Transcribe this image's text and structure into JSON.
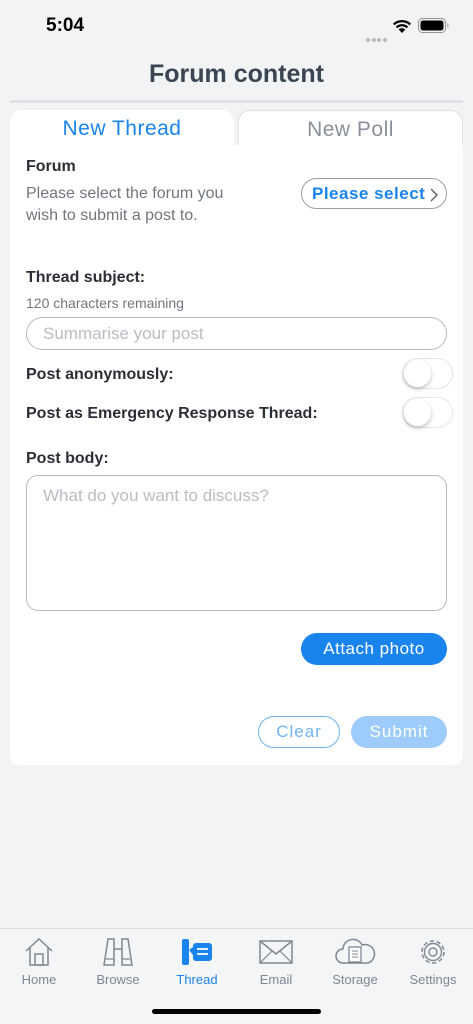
{
  "status_bar": {
    "time": "5:04"
  },
  "page": {
    "title": "Forum content"
  },
  "tabs": [
    {
      "label": "New Thread",
      "active": true
    },
    {
      "label": "New Poll",
      "active": false
    }
  ],
  "form": {
    "forum": {
      "label": "Forum",
      "hint_line1": "Please select the forum you",
      "hint_line2": "wish to submit a post to.",
      "select_label": "Please select"
    },
    "subject": {
      "label": "Thread subject:",
      "remaining": "120 characters remaining",
      "value": "",
      "placeholder": "Summarise your post"
    },
    "anonymous": {
      "label": "Post anonymously:",
      "on": false
    },
    "emergency": {
      "label": "Post as Emergency Response Thread:",
      "on": false
    },
    "body": {
      "label": "Post body:",
      "value": "",
      "placeholder": "What do you want to discuss?"
    },
    "attach_label": "Attach photo",
    "clear_label": "Clear",
    "submit_label": "Submit"
  },
  "tab_bar": [
    {
      "label": "Home",
      "icon": "home-icon",
      "active": false
    },
    {
      "label": "Browse",
      "icon": "binoculars-icon",
      "active": false
    },
    {
      "label": "Thread",
      "icon": "thread-icon",
      "active": true
    },
    {
      "label": "Email",
      "icon": "envelope-icon",
      "active": false
    },
    {
      "label": "Storage",
      "icon": "cloud-storage-icon",
      "active": false
    },
    {
      "label": "Settings",
      "icon": "gear-icon",
      "active": false
    }
  ],
  "colors": {
    "accent": "#1a84ee",
    "inactive": "#808791",
    "background": "#f2f3f5"
  }
}
